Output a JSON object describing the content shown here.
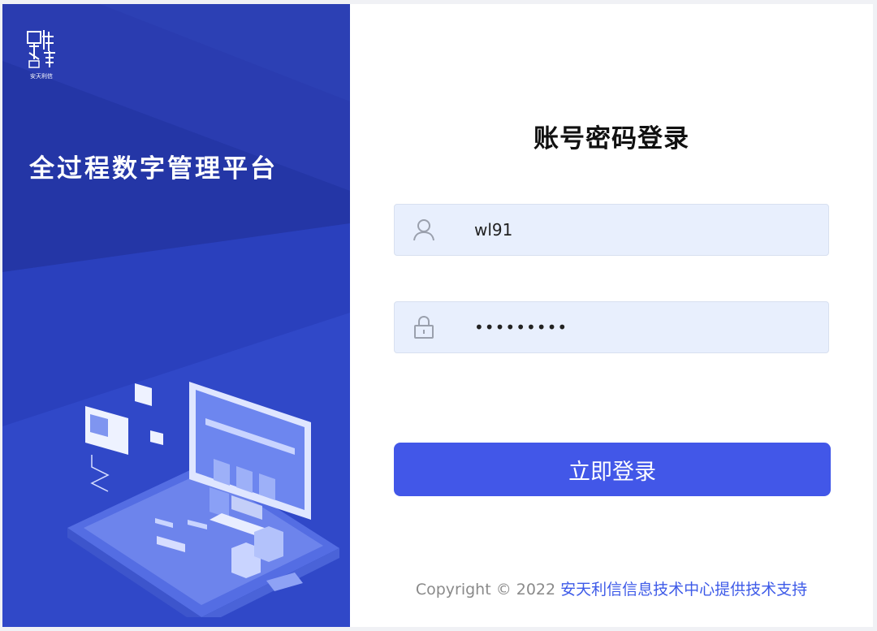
{
  "brand": {
    "logo_caption": "安天利信",
    "platform_title": "全过程数字管理平台"
  },
  "login": {
    "title": "账号密码登录",
    "username_value": "wl91",
    "password_value": "•••••••••",
    "submit_label": "立即登录"
  },
  "footer": {
    "copyright": "Copyright © 2022 ",
    "support_link": "安天利信信息技术中心提供技术支持"
  },
  "colors": {
    "left_panel": "#2436a6",
    "primary_button": "#4257e8",
    "input_bg": "#e8effd",
    "link": "#3d5ae8"
  },
  "icons": {
    "username": "user-icon",
    "password": "lock-icon"
  }
}
